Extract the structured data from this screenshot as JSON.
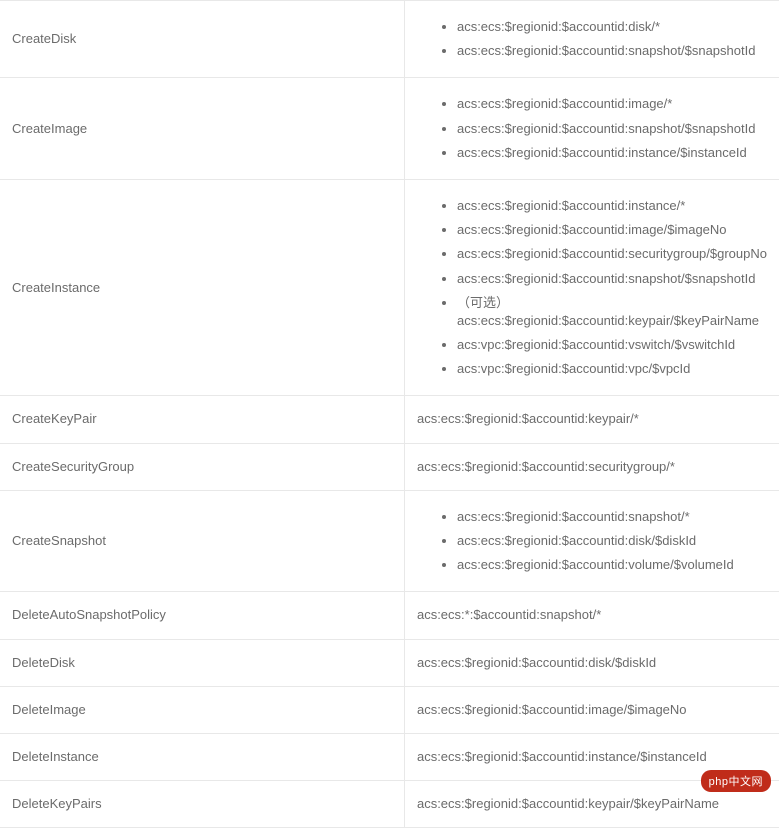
{
  "rows": [
    {
      "action": "CreateDisk",
      "resources": [
        "acs:ecs:$regionid:$accountid:disk/*",
        "acs:ecs:$regionid:$accountid:snapshot/$snapshotId"
      ],
      "type": "list"
    },
    {
      "action": "CreateImage",
      "resources": [
        "acs:ecs:$regionid:$accountid:image/*",
        "acs:ecs:$regionid:$accountid:snapshot/$snapshotId",
        "acs:ecs:$regionid:$accountid:instance/$instanceId"
      ],
      "type": "list"
    },
    {
      "action": "CreateInstance",
      "resources": [
        "acs:ecs:$regionid:$accountid:instance/*",
        "acs:ecs:$regionid:$accountid:image/$imageNo",
        "acs:ecs:$regionid:$accountid:securitygroup/$groupNo",
        "acs:ecs:$regionid:$accountid:snapshot/$snapshotId",
        "（可选）acs:ecs:$regionid:$accountid:keypair/$keyPairName",
        "acs:vpc:$regionid:$accountid:vswitch/$vswitchId",
        "acs:vpc:$regionid:$accountid:vpc/$vpcId"
      ],
      "type": "list"
    },
    {
      "action": "CreateKeyPair",
      "resources": [
        "acs:ecs:$regionid:$accountid:keypair/*"
      ],
      "type": "plain"
    },
    {
      "action": "CreateSecurityGroup",
      "resources": [
        "acs:ecs:$regionid:$accountid:securitygroup/*"
      ],
      "type": "plain"
    },
    {
      "action": "CreateSnapshot",
      "resources": [
        "acs:ecs:$regionid:$accountid:snapshot/*",
        "acs:ecs:$regionid:$accountid:disk/$diskId",
        "acs:ecs:$regionid:$accountid:volume/$volumeId"
      ],
      "type": "list"
    },
    {
      "action": "DeleteAutoSnapshotPolicy",
      "resources": [
        "acs:ecs:*:$accountid:snapshot/*"
      ],
      "type": "plain"
    },
    {
      "action": "DeleteDisk",
      "resources": [
        "acs:ecs:$regionid:$accountid:disk/$diskId"
      ],
      "type": "plain"
    },
    {
      "action": "DeleteImage",
      "resources": [
        "acs:ecs:$regionid:$accountid:image/$imageNo"
      ],
      "type": "plain"
    },
    {
      "action": "DeleteInstance",
      "resources": [
        "acs:ecs:$regionid:$accountid:instance/$instanceId"
      ],
      "type": "plain"
    },
    {
      "action": "DeleteKeyPairs",
      "resources": [
        "acs:ecs:$regionid:$accountid:keypair/$keyPairName"
      ],
      "type": "plain"
    }
  ],
  "badge": "php中文网"
}
